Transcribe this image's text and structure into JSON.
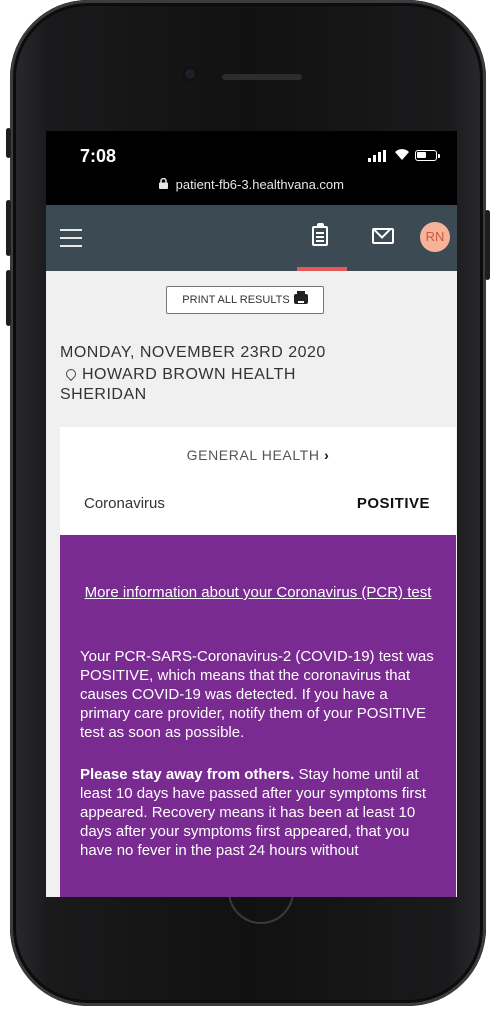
{
  "status_bar": {
    "time": "7:08",
    "url": "patient-fb6-3.healthvana.com"
  },
  "header": {
    "avatar_initials": "RN"
  },
  "print_button_label": "PRINT ALL RESULTS",
  "visit": {
    "date": "MONDAY, NOVEMBER 23RD 2020",
    "location": "HOWARD BROWN HEALTH SHERIDAN"
  },
  "result": {
    "category": "GENERAL HEALTH",
    "test_name": "Coronavirus",
    "status": "POSITIVE"
  },
  "info": {
    "title": "More information about your Coronavirus (PCR) test",
    "paragraph1": "Your PCR-SARS-Coronavirus-2 (COVID-19) test was POSITIVE, which means that the coronavirus that causes COVID-19 was detected. If you have a primary care provider, notify them of your POSITIVE test as soon as possible.",
    "paragraph2_bold": "Please stay away from others.",
    "paragraph2": " Stay home until at least 10 days have passed after your symptoms first appeared. Recovery means it has been at least 10 days after your symptoms first appeared, that you have no fever in the past 24 hours without"
  },
  "colors": {
    "navbar": "#3c4a54",
    "accent": "#e35a58",
    "info_bg": "#7a2b91",
    "avatar_bg": "#f7b39a"
  },
  "icons": [
    "lock-icon",
    "signal-icon",
    "wifi-icon",
    "battery-icon",
    "menu-icon",
    "results-icon",
    "mail-icon",
    "printer-icon",
    "pin-icon",
    "chevron-right-icon"
  ]
}
